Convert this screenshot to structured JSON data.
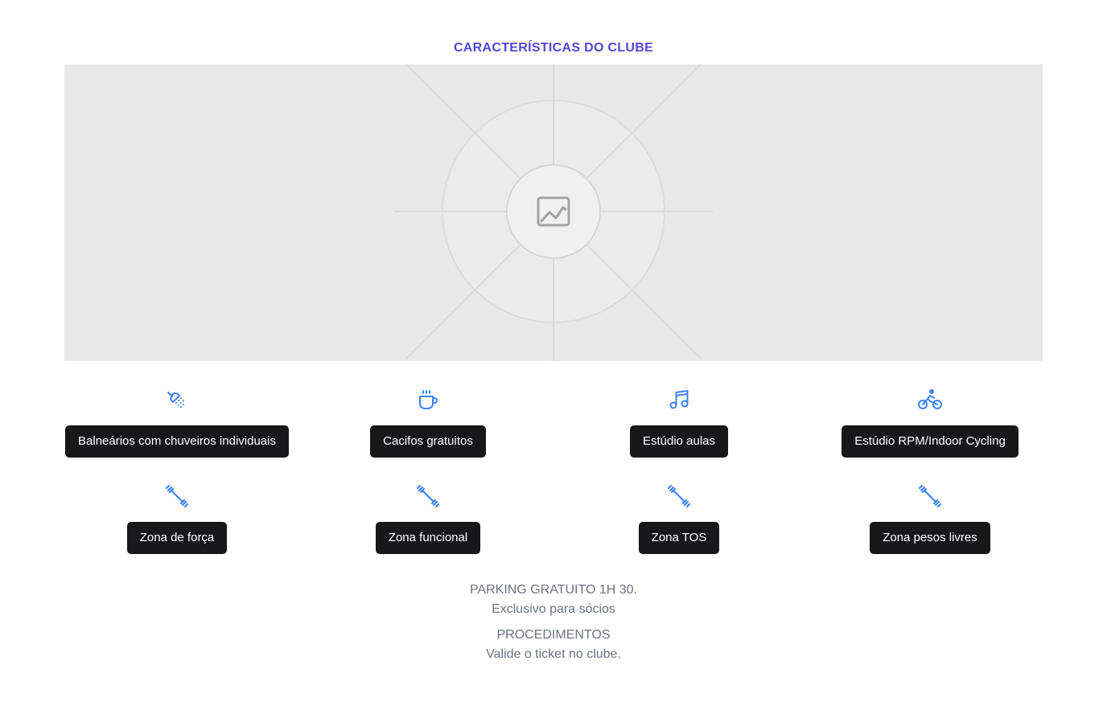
{
  "section": {
    "title": "CARACTERÍSTICAS DO CLUBE"
  },
  "hero": {
    "icon": "image-placeholder-icon"
  },
  "colors": {
    "title": "#5146d6",
    "icon": "#3b82f6",
    "pill_bg": "#18181b",
    "info_text": "#6b7280",
    "placeholder_bg": "#e8e8e8"
  },
  "features": [
    {
      "icon": "shower-icon",
      "label": "Balneários com chuveiros individuais"
    },
    {
      "icon": "coffee-cup-icon",
      "label": "Cacifos gratuitos"
    },
    {
      "icon": "music-note-icon",
      "label": "Estúdio aulas"
    },
    {
      "icon": "bicycle-icon",
      "label": "Estúdio RPM/Indoor Cycling"
    },
    {
      "icon": "dumbbell-icon",
      "label": "Zona de força"
    },
    {
      "icon": "dumbbell-icon",
      "label": "Zona funcional"
    },
    {
      "icon": "dumbbell-icon",
      "label": "Zona TOS"
    },
    {
      "icon": "dumbbell-icon",
      "label": "Zona pesos livres"
    }
  ],
  "parking": {
    "line1": "PARKING GRATUITO 1H 30.",
    "line2": "Exclusivo para sócios",
    "line3": "PROCEDIMENTOS",
    "line4": "Valide o ticket no clube."
  }
}
